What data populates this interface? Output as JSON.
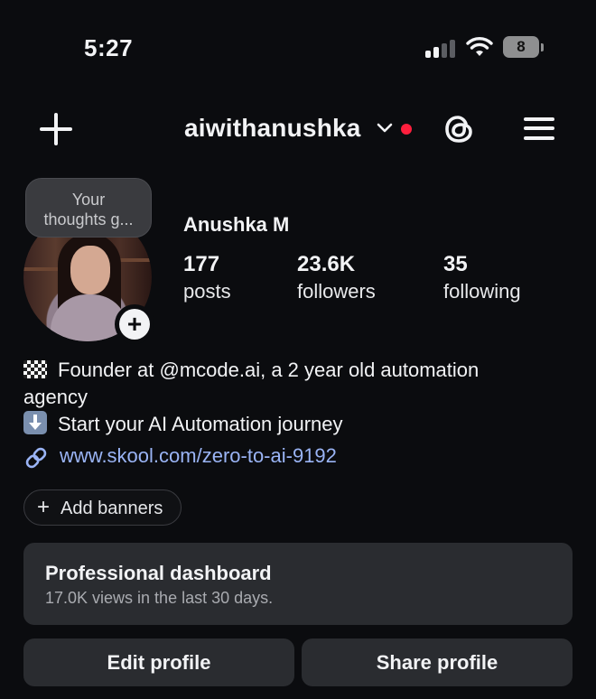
{
  "status_bar": {
    "time": "5:27",
    "battery": "8"
  },
  "header": {
    "username": "aiwithanushka"
  },
  "note": {
    "line1": "Your",
    "line2": "thoughts g..."
  },
  "profile": {
    "name": "Anushka M",
    "stats": [
      {
        "value": "177",
        "label": "posts"
      },
      {
        "value": "23.6K",
        "label": "followers"
      },
      {
        "value": "35",
        "label": "following"
      }
    ]
  },
  "bio": {
    "line1": "Founder at @mcode.ai, a 2 year old automation",
    "line2": "agency",
    "line3": "Start your AI Automation journey",
    "link": "www.skool.com/zero-to-ai-9192"
  },
  "add_banners": {
    "label": "Add banners"
  },
  "dashboard": {
    "title": "Professional dashboard",
    "subtitle": "17.0K views in the last 30 days."
  },
  "buttons": {
    "edit": "Edit profile",
    "share": "Share profile"
  },
  "colors": {
    "background": "#0b0c0f",
    "link": "#9ab4f5",
    "live_dot": "#ff1f3d",
    "card": "#2a2c30"
  }
}
